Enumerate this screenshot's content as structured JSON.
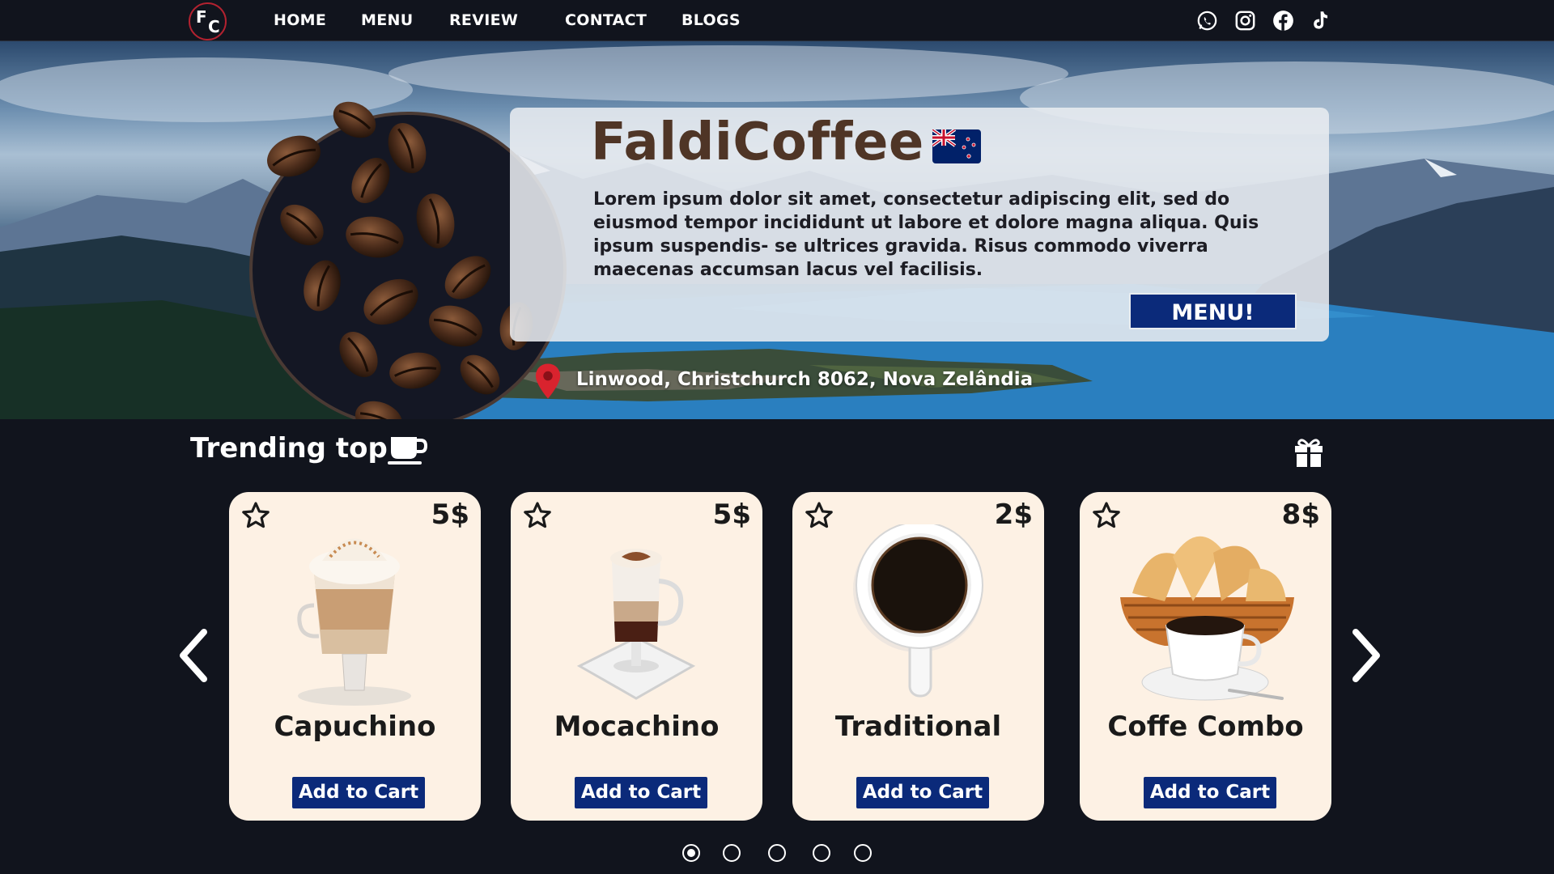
{
  "logo": {
    "letters": "FC",
    "f": "F",
    "c": "C"
  },
  "nav": {
    "links": [
      "HOME",
      "MENU",
      "REVIEW",
      "CONTACT",
      "BLOGS"
    ],
    "social_icons": [
      "whatsapp-icon",
      "instagram-icon",
      "facebook-icon",
      "tiktok-icon"
    ]
  },
  "hero": {
    "title": "FaldiCoffee",
    "flag": "new-zealand-flag",
    "text": "Lorem ipsum dolor sit amet, consectetur adipiscing elit, sed do eiusmod tempor incididunt ut labore et dolore magna aliqua. Quis ipsum suspendis- se ultrices gravida. Risus commodo viverra maecenas accumsan lacus vel facilisis.",
    "menu_button": "MENU!",
    "location": "Linwood, Christchurch 8062, Nova Zelândia"
  },
  "trending": {
    "title": "Trending top",
    "cards": [
      {
        "name": "Capuchino",
        "price": "5$",
        "button": "Add to Cart"
      },
      {
        "name": "Mocachino",
        "price": "5$",
        "button": "Add to Cart"
      },
      {
        "name": "Traditional",
        "price": "2$",
        "button": "Add to Cart"
      },
      {
        "name": "Coffe Combo",
        "price": "8$",
        "button": "Add to Cart"
      }
    ],
    "carousel": {
      "pages": 5,
      "active_page": 1
    }
  },
  "colors": {
    "nav_bg": "#11141d",
    "button_blue": "#0b2a7a",
    "card_bg": "#fdf1e4",
    "title_brown": "#4f3526",
    "pin_red": "#d9232e"
  }
}
